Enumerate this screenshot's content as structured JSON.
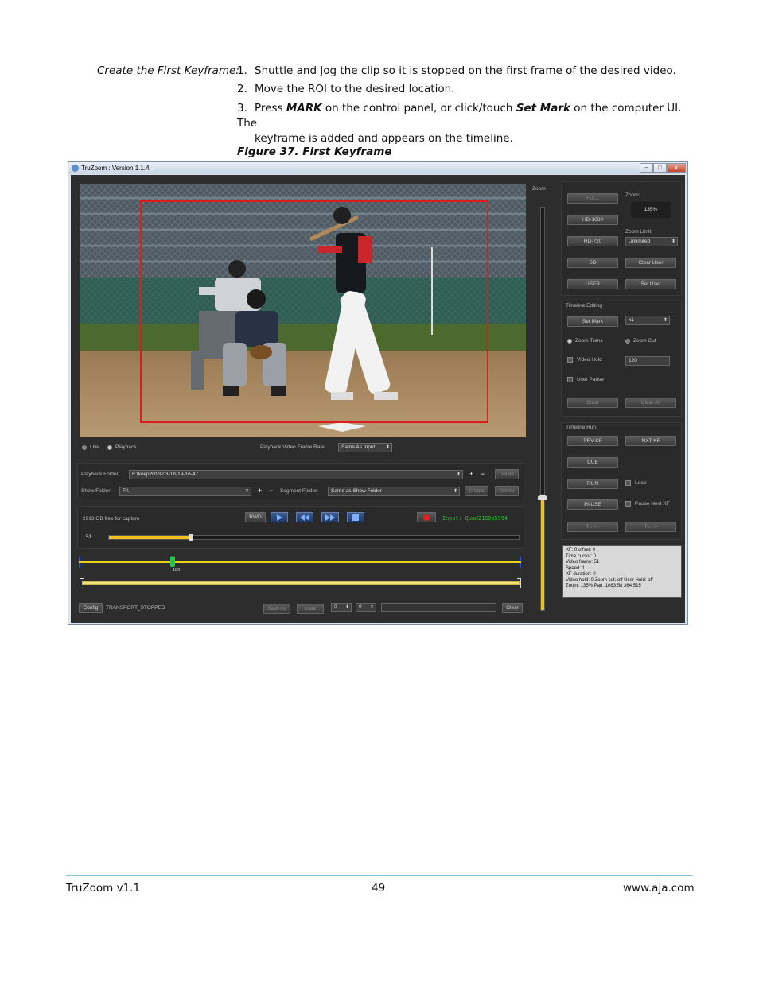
{
  "doc": {
    "side_label": "Create the First Keyframe:",
    "steps": [
      {
        "num": "1.",
        "text": "Shuttle and Jog the clip so it is stopped on the first frame of the desired video."
      },
      {
        "num": "2.",
        "text": "Move the ROI to the desired location."
      },
      {
        "num": "3.",
        "text_a": "Press ",
        "bold_a": "MARK",
        "text_b": " on the control panel, or click/touch ",
        "bold_b": "Set Mark",
        "text_c": " on the computer UI. The",
        "text_d": "keyframe is added and appears on the timeline."
      }
    ],
    "figure_caption": "Figure 37. First Keyframe"
  },
  "window": {
    "title": "TruZoom : Version 1.1.4",
    "min": "–",
    "max": "□",
    "close": "x"
  },
  "video": {
    "roi_color": "#e01b1b",
    "live_label": "Live",
    "playback_label": "Playback",
    "rate_label": "Playback Video Frame Rate",
    "rate_value": "Same As Input"
  },
  "folders": {
    "playback_label": "Playback Folder:",
    "playback_value": "F:\\keep2013-03-18-19-16-47",
    "plus": "+",
    "minus": "−",
    "delete": "Delete",
    "show_label": "Show Folder:",
    "show_value": "F:\\",
    "segment_label": "Segment Folder:",
    "segment_value": "Same as Show Folder",
    "create": "Create",
    "delete2": "Delete"
  },
  "transport": {
    "free": "2913 GB free for capture",
    "rwd": "RWD",
    "input": "Input: Quad2160p5994",
    "frame": "51",
    "progress": 0.2,
    "timeline_kf_top": "51",
    "timeline_kf_bottom": "100",
    "config": "Config",
    "status": "TRANSPORT_STOPPED",
    "save_as": "Save As",
    "load": "Load",
    "spin1": "0",
    "spin2": "0",
    "clear": "Clear"
  },
  "zoom_col": {
    "label": "Zoom",
    "level": 0.28
  },
  "right": {
    "full": "FULL",
    "hd1080": "HD-1080",
    "hd720": "HD-720",
    "sd": "SD",
    "user": "USER",
    "zoom_label": "Zoom:",
    "zoom_value": "135%",
    "zoom_limit_label": "Zoom Limit:",
    "zoom_limit_value": "Unlimited",
    "clear_user": "Clear User",
    "set_user": "Set User",
    "tl_edit_title": "Timeline Editing",
    "set_mark": "Set Mark",
    "x1": "x1",
    "zoom_trans": "Zoom Trans",
    "zoom_cut": "Zoom Cut",
    "video_hold": "Video Hold",
    "hold_value": "120",
    "user_pause": "User Pause",
    "clear": "Clear",
    "clear_all": "Clear All",
    "tl_run_title": "Timeline Run",
    "prv_kf": "PRV KF",
    "nxt_kf": "NXT KF",
    "cue": "CUE",
    "run": "RUN",
    "loop": "Loop",
    "pause": "PAUSE",
    "pause_next": "Pause Next KF",
    "tl_left": "TL <--",
    "tl_right": "TL -->",
    "info": [
      "KF: 0 offset: 0",
      "Time cursor: 0",
      "Video frame: 51",
      "Speed: 1",
      "KF duration: 0",
      "Video hold: 0 Zoom cut: off User Hold: off",
      "Zoom: 135% Pan: 1083.58 364.515"
    ]
  },
  "footer": {
    "left": "TruZoom v1.1",
    "page": "49",
    "right": "www.aja.com"
  }
}
